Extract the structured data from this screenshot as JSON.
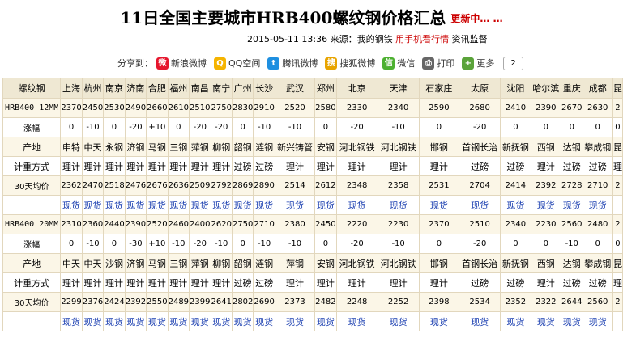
{
  "header": {
    "title": "11日全国主要城市HRB400螺纹钢价格汇总",
    "update": "更新中… …"
  },
  "meta": {
    "datetime": "2015-05-11 13:36",
    "source_label": "来源：",
    "source": "我的钢铁",
    "mobile": "用手机看行情",
    "subscribe": "资讯监督"
  },
  "share": {
    "label": "分享到：",
    "items": [
      {
        "label": "新浪微博",
        "icon": "sina-weibo-icon",
        "color": "#e6162d",
        "glyph": "微"
      },
      {
        "label": "QQ空间",
        "icon": "qzone-icon",
        "color": "#f5b400",
        "glyph": "Q"
      },
      {
        "label": "腾讯微博",
        "icon": "tencent-weibo-icon",
        "color": "#1e8fe0",
        "glyph": "t"
      },
      {
        "label": "搜狐微博",
        "icon": "sohu-weibo-icon",
        "color": "#e8a400",
        "glyph": "搜"
      },
      {
        "label": "微信",
        "icon": "wechat-icon",
        "color": "#4cb030",
        "glyph": "信"
      },
      {
        "label": "打印",
        "icon": "print-icon",
        "color": "#666666",
        "glyph": "⎙"
      },
      {
        "label": "更多",
        "icon": "more-icon",
        "color": "#5aa33a",
        "glyph": "+"
      }
    ],
    "count": "2"
  },
  "table": {
    "header_label": "螺纹钢",
    "cities": [
      "上海",
      "杭州",
      "南京",
      "济南",
      "合肥",
      "福州",
      "南昌",
      "南宁",
      "广州",
      "长沙",
      "武汉",
      "郑州",
      "北京",
      "天津",
      "石家庄",
      "太原",
      "沈阳",
      "哈尔滨",
      "重庆",
      "成都",
      "昆"
    ],
    "groups": [
      {
        "spec": "HRB400 12MM",
        "prices": [
          "2370",
          "2450",
          "2530",
          "2490",
          "2660",
          "2610",
          "2510",
          "2750",
          "2830",
          "2910",
          "2520",
          "2580",
          "2330",
          "2340",
          "2590",
          "2680",
          "2410",
          "2390",
          "2670",
          "2630",
          "2"
        ],
        "change_label": "涨幅",
        "changes": [
          "0",
          "-10",
          "0",
          "-20",
          "+10",
          "0",
          "-20",
          "-20",
          "0",
          "-10",
          "-10",
          "0",
          "-20",
          "-10",
          "0",
          "-20",
          "0",
          "0",
          "0",
          "0",
          "0"
        ],
        "origin_label": "产地",
        "origins": [
          "申特",
          "中天",
          "永钢",
          "济钢",
          "马钢",
          "三钢",
          "萍钢",
          "柳钢",
          "韶钢",
          "涟钢",
          "新兴铸管",
          "安钢",
          "河北钢铁",
          "河北钢铁",
          "邯钢",
          "首钢长治",
          "新抚钢",
          "西钢",
          "达钢",
          "攀成钢",
          "昆"
        ],
        "method_label": "计重方式",
        "methods": [
          "理计",
          "理计",
          "理计",
          "理计",
          "理计",
          "理计",
          "理计",
          "理计",
          "过磅",
          "过磅",
          "理计",
          "理计",
          "理计",
          "理计",
          "理计",
          "过磅",
          "过磅",
          "理计",
          "过磅",
          "过磅",
          "理"
        ],
        "avg_label": "30天均价",
        "avgs": [
          "2362",
          "2470",
          "2518",
          "2476",
          "2676",
          "2636",
          "2509",
          "2792",
          "2869",
          "2890",
          "2514",
          "2612",
          "2348",
          "2358",
          "2531",
          "2704",
          "2414",
          "2392",
          "2728",
          "2710",
          "2"
        ],
        "link_text": "现货"
      },
      {
        "spec": "HRB400 20MM",
        "prices": [
          "2310",
          "2360",
          "2440",
          "2390",
          "2520",
          "2460",
          "2400",
          "2620",
          "2750",
          "2710",
          "2380",
          "2450",
          "2220",
          "2230",
          "2370",
          "2510",
          "2340",
          "2230",
          "2560",
          "2480",
          "2"
        ],
        "change_label": "涨幅",
        "changes": [
          "0",
          "-10",
          "0",
          "-30",
          "+10",
          "-10",
          "-20",
          "-10",
          "0",
          "-10",
          "-10",
          "0",
          "-20",
          "-10",
          "0",
          "-20",
          "0",
          "0",
          "-10",
          "0",
          "0"
        ],
        "origin_label": "产地",
        "origins": [
          "中天",
          "中天",
          "沙钢",
          "济钢",
          "马钢",
          "三钢",
          "萍钢",
          "柳钢",
          "韶钢",
          "涟钢",
          "萍钢",
          "安钢",
          "河北钢铁",
          "河北钢铁",
          "邯钢",
          "首钢长治",
          "新抚钢",
          "西钢",
          "达钢",
          "攀成钢",
          "昆"
        ],
        "method_label": "计重方式",
        "methods": [
          "理计",
          "理计",
          "理计",
          "理计",
          "理计",
          "理计",
          "理计",
          "理计",
          "过磅",
          "过磅",
          "理计",
          "理计",
          "理计",
          "理计",
          "理计",
          "过磅",
          "过磅",
          "理计",
          "过磅",
          "过磅",
          "理"
        ],
        "avg_label": "30天均价",
        "avgs": [
          "2299",
          "2376",
          "2424",
          "2392",
          "2550",
          "2489",
          "2399",
          "2641",
          "2802",
          "2690",
          "2373",
          "2482",
          "2248",
          "2252",
          "2398",
          "2534",
          "2352",
          "2322",
          "2644",
          "2560",
          "2"
        ],
        "link_text": "现货"
      }
    ]
  }
}
